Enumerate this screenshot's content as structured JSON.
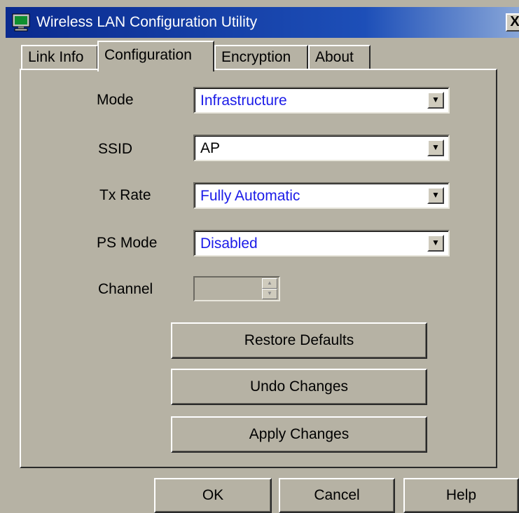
{
  "window": {
    "title": "Wireless LAN Configuration Utility",
    "close_symbol": "X"
  },
  "tabs": [
    {
      "label": "Link Info",
      "active": false
    },
    {
      "label": "Configuration",
      "active": true
    },
    {
      "label": "Encryption",
      "active": false
    },
    {
      "label": "About",
      "active": false
    }
  ],
  "config": {
    "mode": {
      "label": "Mode",
      "value": "Infrastructure"
    },
    "ssid": {
      "label": "SSID",
      "value": "AP"
    },
    "tx_rate": {
      "label": "Tx Rate",
      "value": "Fully Automatic"
    },
    "ps_mode": {
      "label": "PS Mode",
      "value": "Disabled"
    },
    "channel": {
      "label": "Channel",
      "value": ""
    }
  },
  "buttons": {
    "restore": "Restore Defaults",
    "undo": "Undo Changes",
    "apply": "Apply Changes",
    "ok": "OK",
    "cancel": "Cancel",
    "help": "Help"
  },
  "icons": {
    "app": "network-computer-icon",
    "dropdown": "chevron-down-icon",
    "spin_up": "spin-up-icon",
    "spin_down": "spin-down-icon"
  },
  "colors": {
    "title_bar": "#0a2a8e",
    "face": "#b6b2a4",
    "value_text": "#1b1be8"
  }
}
